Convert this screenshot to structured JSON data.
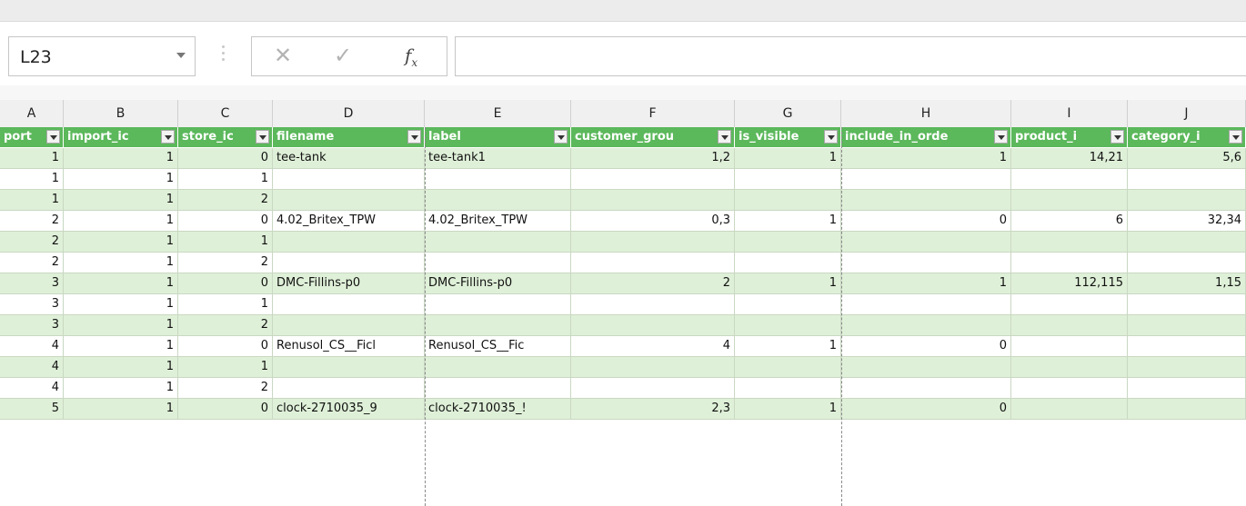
{
  "name_box": "L23",
  "formula_bar": {
    "cancel": "✕",
    "enter": "✓",
    "fx": "fx",
    "value": ""
  },
  "columns": [
    "A",
    "B",
    "C",
    "D",
    "E",
    "F",
    "G",
    "H",
    "I",
    "J"
  ],
  "headers": [
    "port",
    "import_ic",
    "store_ic",
    "filename",
    "label",
    "customer_grou",
    "is_visible",
    "include_in_orde",
    "product_i",
    "category_i"
  ],
  "rows": [
    [
      "1",
      "1",
      "0",
      "tee-tank",
      "tee-tank1",
      "1,2",
      "1",
      "1",
      "14,21",
      "5,6"
    ],
    [
      "1",
      "1",
      "1",
      "",
      "",
      "",
      "",
      "",
      "",
      ""
    ],
    [
      "1",
      "1",
      "2",
      "",
      "",
      "",
      "",
      "",
      "",
      ""
    ],
    [
      "2",
      "1",
      "0",
      "4.02_Britex_TPW",
      "4.02_Britex_TPW",
      "0,3",
      "1",
      "0",
      "6",
      "32,34"
    ],
    [
      "2",
      "1",
      "1",
      "",
      "",
      "",
      "",
      "",
      "",
      ""
    ],
    [
      "2",
      "1",
      "2",
      "",
      "",
      "",
      "",
      "",
      "",
      ""
    ],
    [
      "3",
      "1",
      "0",
      "DMC-Fillins-p0",
      "DMC-Fillins-p0",
      "2",
      "1",
      "1",
      "112,115",
      "1,15"
    ],
    [
      "3",
      "1",
      "1",
      "",
      "",
      "",
      "",
      "",
      "",
      ""
    ],
    [
      "3",
      "1",
      "2",
      "",
      "",
      "",
      "",
      "",
      "",
      ""
    ],
    [
      "4",
      "1",
      "0",
      "Renusol_CS__Ficl",
      "Renusol_CS__Fic",
      "4",
      "1",
      "0",
      "",
      ""
    ],
    [
      "4",
      "1",
      "1",
      "",
      "",
      "",
      "",
      "",
      "",
      ""
    ],
    [
      "4",
      "1",
      "2",
      "",
      "",
      "",
      "",
      "",
      "",
      ""
    ],
    [
      "5",
      "1",
      "0",
      "clock-2710035_9",
      "clock-2710035_!",
      "2,3",
      "1",
      "0",
      "",
      ""
    ]
  ],
  "colors": {
    "header_green": "#5bb85b",
    "band_green": "#dff0d8"
  }
}
